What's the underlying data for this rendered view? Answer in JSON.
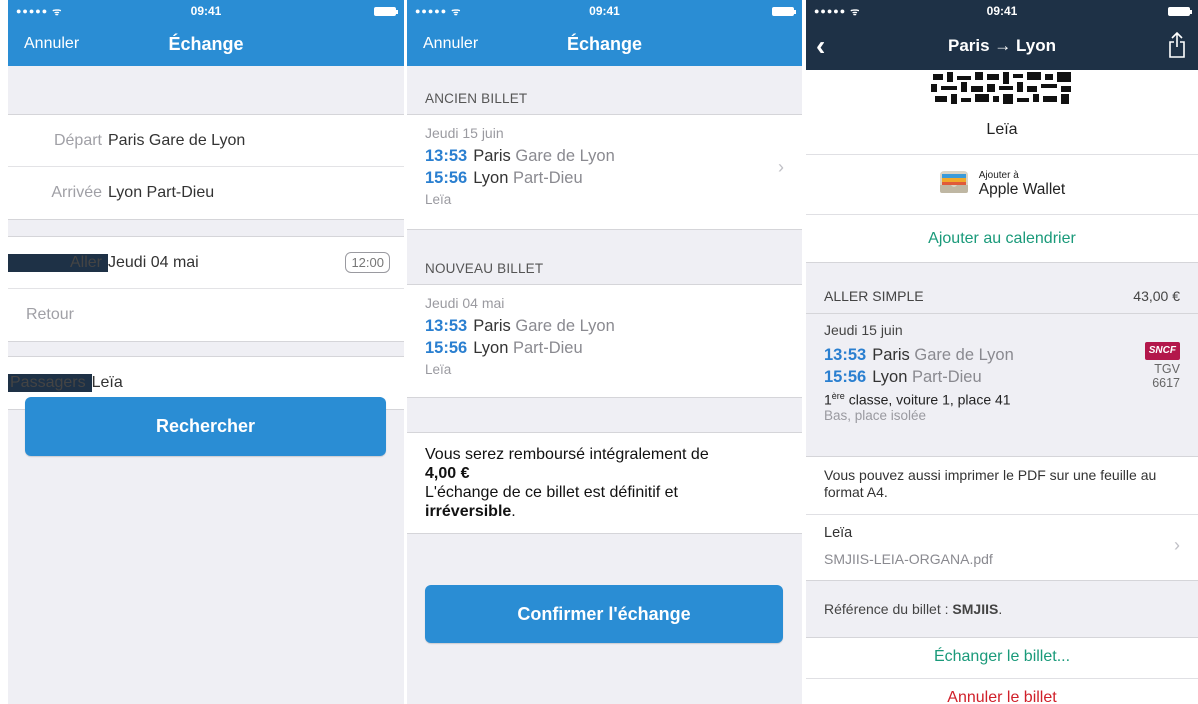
{
  "statusbar": {
    "time": "09:41",
    "signal": "●●●●● ",
    "wifi": "ᯤ"
  },
  "screen1": {
    "nav": {
      "cancel": "Annuler",
      "title": "Échange"
    },
    "form": {
      "depart_label": "Départ",
      "depart_value": "Paris Gare de Lyon",
      "arrivee_label": "Arrivée",
      "arrivee_value": "Lyon Part-Dieu",
      "aller_label": "Aller",
      "aller_value": "Jeudi 04 mai",
      "aller_time": "12:00",
      "retour_label": "Retour",
      "passagers_label": "Passagers",
      "passagers_value": "Leïa"
    },
    "search_button": "Rechercher"
  },
  "screen2": {
    "nav": {
      "cancel": "Annuler",
      "title": "Échange"
    },
    "old_ticket": {
      "header": "ANCIEN BILLET",
      "date": "Jeudi 15 juin",
      "dep_time": "13:53",
      "dep_city": "Paris",
      "dep_station": "Gare de Lyon",
      "arr_time": "15:56",
      "arr_city": "Lyon",
      "arr_station": "Part-Dieu",
      "passenger": "Leïa"
    },
    "new_ticket": {
      "header": "NOUVEAU BILLET",
      "date": "Jeudi 04 mai",
      "dep_time": "13:53",
      "dep_city": "Paris",
      "dep_station": "Gare de Lyon",
      "arr_time": "15:56",
      "arr_city": "Lyon",
      "arr_station": "Part-Dieu",
      "passenger": "Leïa"
    },
    "notice": {
      "line1": "Vous serez remboursé intégralement de",
      "amount": "4,00 €",
      "line2": "L'échange de ce billet est définitif et",
      "irreversible": "irréversible",
      "dot": "."
    },
    "confirm_button": "Confirmer l'échange"
  },
  "screen3": {
    "nav": {
      "title": "Paris → Lyon"
    },
    "passenger_name": "Leïa",
    "wallet": {
      "small": "Ajouter à",
      "big": "Apple Wallet"
    },
    "add_calendar": "Ajouter au calendrier",
    "trip": {
      "type": "ALLER SIMPLE",
      "price": "43,00 €",
      "date": "Jeudi 15 juin",
      "dep_time": "13:53",
      "dep_city": "Paris",
      "dep_station": "Gare de Lyon",
      "arr_time": "15:56",
      "arr_city": "Lyon",
      "arr_station": "Part-Dieu",
      "operator_logo": "SNCF",
      "train_type": "TGV",
      "train_number": "6617",
      "class_sup": "ère",
      "class_num": "1",
      "seat": "classe, voiture 1, place 41",
      "seat_detail": "Bas, place isolée"
    },
    "pdf_notice": "Vous pouvez aussi imprimer le PDF sur une feuille au format A4.",
    "pdf": {
      "name": "Leïa",
      "file": "SMJIIS-LEIA-ORGANA.pdf"
    },
    "reference_label": "Référence du billet :",
    "reference_value": "SMJIIS",
    "exchange": "Échanger le billet...",
    "cancel": "Annuler le billet",
    "colors": {
      "blue": "#2a8dd4",
      "dark_nav": "#1e3146",
      "green": "#1a9a7a",
      "red": "#d0202a"
    }
  }
}
